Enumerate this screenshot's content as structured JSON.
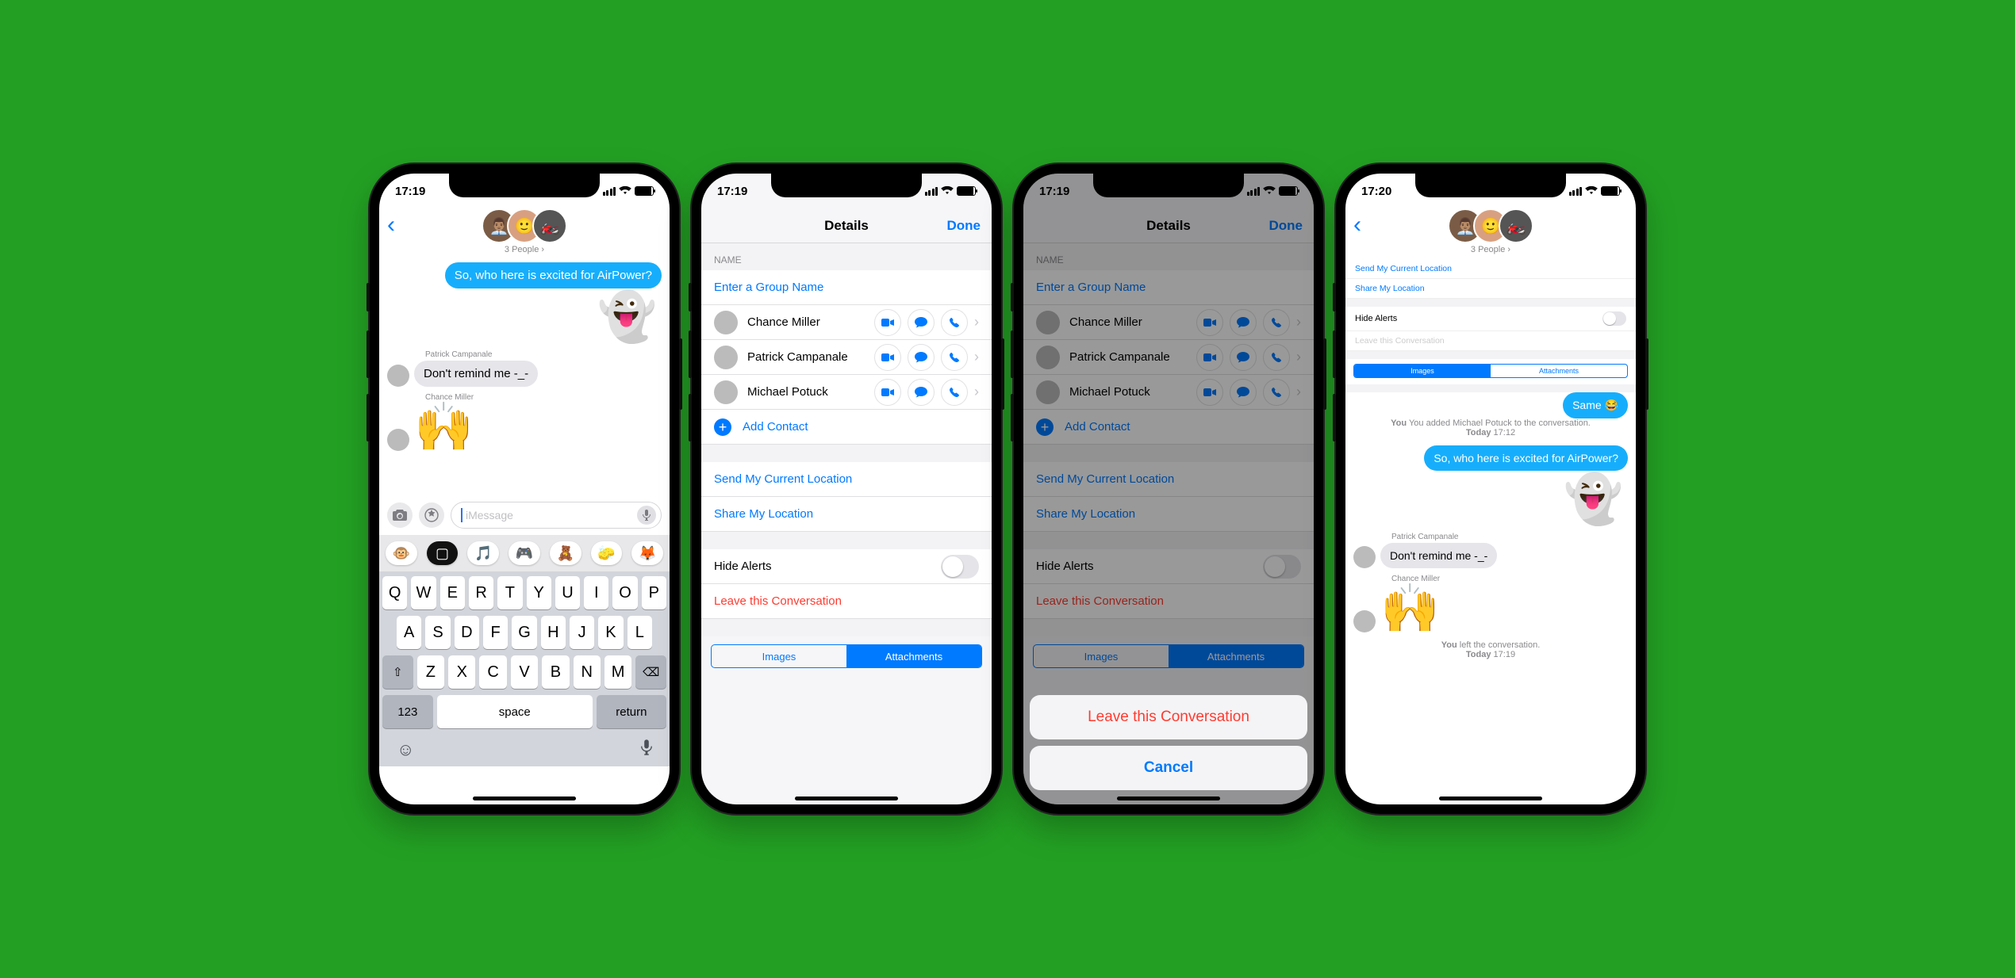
{
  "phone1": {
    "time": "17:19",
    "subtitle": "3 People",
    "bubble_out": "So, who here is excited for AirPower?",
    "sender1": "Patrick Campanale",
    "bubble_in1": "Don't remind me -_-",
    "sender2": "Chance Miller",
    "input_placeholder": "iMessage",
    "keys_r1": [
      "Q",
      "W",
      "E",
      "R",
      "T",
      "Y",
      "U",
      "I",
      "O",
      "P"
    ],
    "keys_r2": [
      "A",
      "S",
      "D",
      "F",
      "G",
      "H",
      "J",
      "K",
      "L"
    ],
    "keys_r3": [
      "Z",
      "X",
      "C",
      "V",
      "B",
      "N",
      "M"
    ],
    "key_123": "123",
    "key_space": "space",
    "key_return": "return"
  },
  "details": {
    "title": "Details",
    "done": "Done",
    "name_header": "NAME",
    "group_name_placeholder": "Enter a Group Name",
    "contacts": [
      {
        "name": "Chance Miller"
      },
      {
        "name": "Patrick Campanale"
      },
      {
        "name": "Michael Potuck"
      }
    ],
    "add_contact": "Add Contact",
    "send_loc": "Send My Current Location",
    "share_loc": "Share My Location",
    "hide_alerts": "Hide Alerts",
    "leave": "Leave this Conversation",
    "seg_images": "Images",
    "seg_attachments": "Attachments"
  },
  "sheet": {
    "leave": "Leave this Conversation",
    "cancel": "Cancel"
  },
  "phone4": {
    "time": "17:20",
    "subtitle": "3 People",
    "send_loc": "Send My Current Location",
    "share_loc": "Share My Location",
    "hide_alerts": "Hide Alerts",
    "leave": "Leave this Conversation",
    "seg_images": "Images",
    "seg_attachments": "Attachments",
    "same": "Same 😂",
    "sys1_a": "You added Michael Potuck to the conversation.",
    "sys1_b": "Today 17:12",
    "bubble_out": "So, who here is excited for AirPower?",
    "sender1": "Patrick Campanale",
    "bubble_in1": "Don't remind me -_-",
    "sender2": "Chance Miller",
    "sys2_a": "You left the conversation.",
    "sys2_b": "Today 17:19"
  }
}
